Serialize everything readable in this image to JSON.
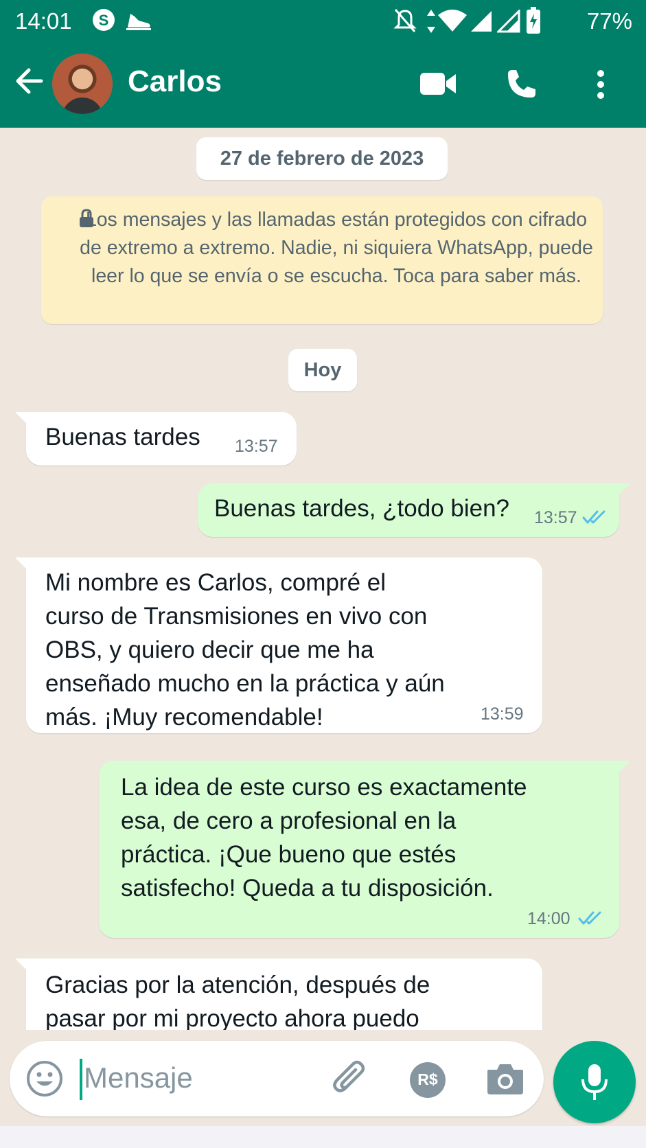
{
  "status_bar": {
    "time": "14:01",
    "battery": "77%",
    "icons": [
      "s-app-icon",
      "sneaker-icon",
      "mute-icon",
      "data-arrows-icon",
      "wifi-icon",
      "signal-icon",
      "signal-icon-2",
      "battery-charging-icon"
    ]
  },
  "header": {
    "contact_name": "Carlos",
    "back_icon": "arrow-left-icon",
    "actions": [
      "video-call-icon",
      "phone-icon",
      "more-vert-icon"
    ]
  },
  "chat": {
    "date_chip": "27 de febrero de 2023",
    "encryption_notice": "Los mensajes y las llamadas están protegidos con cifrado de extremo a extremo. Nadie, ni siquiera WhatsApp, puede leer lo que se envía o se escucha. Toca para saber más.",
    "today_chip": "Hoy",
    "messages": [
      {
        "direction": "in",
        "text": "Buenas tardes",
        "time": "13:57"
      },
      {
        "direction": "out",
        "text": "Buenas tardes, ¿todo bien?",
        "time": "13:57",
        "status": "read"
      },
      {
        "direction": "in",
        "text": "Mi nombre es Carlos, compré el\ncurso de Transmisiones en vivo con\nOBS, y quiero decir que me ha\nenseñado mucho en la práctica y aún\nmás. ¡Muy recomendable!",
        "time": "13:59"
      },
      {
        "direction": "out",
        "text": "La idea de este curso es exactamente\nesa, de cero a profesional en la\npráctica. ¡Que bueno que estés\nsatisfecho! Queda a tu disposición.",
        "time": "14:00",
        "status": "read"
      },
      {
        "direction": "in",
        "text": "Gracias por la atención, después de\npasar por mi proyecto ahora puedo"
      }
    ]
  },
  "composer": {
    "placeholder": "Mensaje",
    "icons": [
      "emoji-icon",
      "attach-icon",
      "payment-icon",
      "camera-icon",
      "mic-icon"
    ],
    "payment_label": "R$"
  },
  "colors": {
    "header": "#008069",
    "chat_bg": "#efe7de",
    "outgoing_bubble": "#d9fdd3",
    "incoming_bubble": "#ffffff",
    "read_ticks": "#53bdeb",
    "accent": "#00a884"
  }
}
